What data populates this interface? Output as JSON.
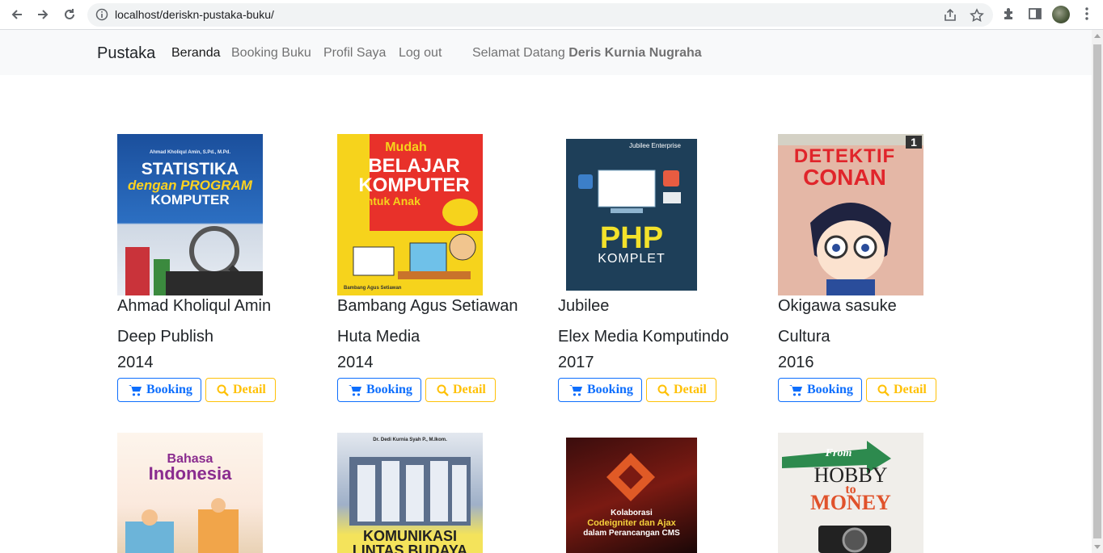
{
  "browser": {
    "url": "localhost/deriskn-pustaka-buku/"
  },
  "navbar": {
    "brand": "Pustaka",
    "links": [
      "Beranda",
      "Booking Buku",
      "Profil Saya",
      "Log out"
    ],
    "welcome_prefix": "Selamat Datang",
    "welcome_user": "Deris Kurnia Nugraha"
  },
  "buttons": {
    "booking": "Booking",
    "detail": "Detail"
  },
  "books": [
    {
      "author": "Ahmad Kholiqul Amin",
      "publisher": "Deep Publish",
      "year": "2014",
      "cover": {
        "line1": "Ahmad Kholiqul Amin, S.Pd., M.Pd.",
        "line2": "STATISTIKA",
        "line3": "dengan PROGRAM",
        "line4": "KOMPUTER"
      }
    },
    {
      "author": "Bambang Agus Setiawan",
      "publisher": "Huta Media",
      "year": "2014",
      "cover": {
        "line1": "Mudah",
        "line2": "BELAJAR",
        "line3": "KOMPUTER",
        "line4": "untuk Anak",
        "line5": "Bambang Agus Setiawan"
      }
    },
    {
      "author": "Jubilee",
      "publisher": "Elex Media Komputindo",
      "year": "2017",
      "cover": {
        "line1": "Jubilee Enterprise",
        "line2": "PHP",
        "line3": "KOMPLET"
      }
    },
    {
      "author": "Okigawa sasuke",
      "publisher": "Cultura",
      "year": "2016",
      "cover": {
        "line1": "DETEKTIF",
        "line2": "CONAN",
        "line3": "1"
      }
    }
  ],
  "row2_covers": [
    {
      "line1": "Bahasa",
      "line2": "Indonesia"
    },
    {
      "line1": "Dr. Dedi Kurnia Syah P., M.Ikom.",
      "line2": "KOMUNIKASI",
      "line3": "LINTAS BUDAYA"
    },
    {
      "line1": "Kolaborasi",
      "line2": "Codeigniter dan Ajax",
      "line3": "dalam Perancangan CMS"
    },
    {
      "line1": "From",
      "line2": "HOBBY",
      "line3": "to",
      "line4": "MONEY"
    }
  ]
}
